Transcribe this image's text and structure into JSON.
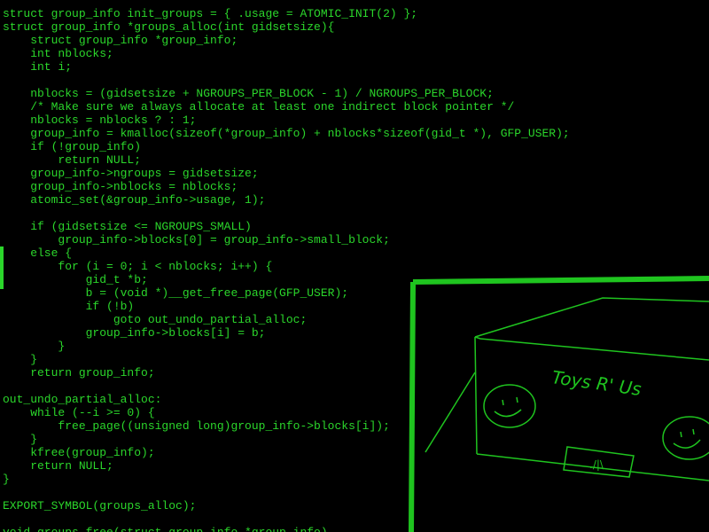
{
  "colors": {
    "background": "#000000",
    "code_text": "#2bd62b",
    "drawing_stroke": "#1fc41f"
  },
  "code": {
    "lines": [
      "struct group_info init_groups = { .usage = ATOMIC_INIT(2) };",
      "struct group_info *groups_alloc(int gidsetsize){",
      "    struct group_info *group_info;",
      "    int nblocks;",
      "    int i;",
      "",
      "    nblocks = (gidsetsize + NGROUPS_PER_BLOCK - 1) / NGROUPS_PER_BLOCK;",
      "    /* Make sure we always allocate at least one indirect block pointer */",
      "    nblocks = nblocks ? : 1;",
      "    group_info = kmalloc(sizeof(*group_info) + nblocks*sizeof(gid_t *), GFP_USER);",
      "    if (!group_info)",
      "        return NULL;",
      "    group_info->ngroups = gidsetsize;",
      "    group_info->nblocks = nblocks;",
      "    atomic_set(&group_info->usage, 1);",
      "",
      "    if (gidsetsize <= NGROUPS_SMALL)",
      "        group_info->blocks[0] = group_info->small_block;",
      "    else {",
      "        for (i = 0; i < nblocks; i++) {",
      "            gid_t *b;",
      "            b = (void *)__get_free_page(GFP_USER);",
      "            if (!b)",
      "                goto out_undo_partial_alloc;",
      "            group_info->blocks[i] = b;",
      "        }",
      "    }",
      "    return group_info;",
      "",
      "out_undo_partial_alloc:",
      "    while (--i >= 0) {",
      "        free_page((unsigned long)group_info->blocks[i]);",
      "    }",
      "    kfree(group_info);",
      "    return NULL;",
      "}",
      "",
      "EXPORT_SYMBOL(groups_alloc);",
      "",
      "void groups_free(struct group_info *group_info)"
    ]
  },
  "drawing": {
    "box_label": "Toys R' Us",
    "slot_label": "./|\\"
  }
}
